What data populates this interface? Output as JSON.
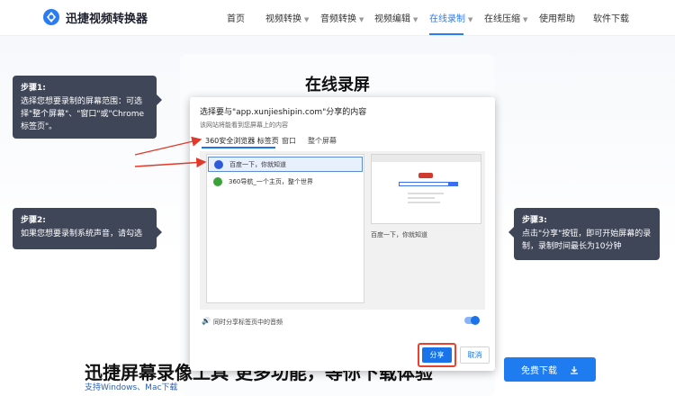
{
  "nav": {
    "brand": "迅捷视频转换器",
    "items": [
      {
        "label": "首页",
        "dropdown": false,
        "active": false
      },
      {
        "label": "视频转换",
        "dropdown": true,
        "active": false
      },
      {
        "label": "音频转换",
        "dropdown": true,
        "active": false
      },
      {
        "label": "视频编辑",
        "dropdown": true,
        "active": false
      },
      {
        "label": "在线录制",
        "dropdown": true,
        "active": true
      },
      {
        "label": "在线压缩",
        "dropdown": true,
        "active": false
      },
      {
        "label": "使用帮助",
        "dropdown": false,
        "active": false
      },
      {
        "label": "软件下载",
        "dropdown": false,
        "active": false
      }
    ],
    "accent_color": "#2b7cf2"
  },
  "page": {
    "title": "在线录屏",
    "heading": "迅捷屏幕录像工具 更多功能，等你下载体验",
    "support": "支持Windows、Mac下载",
    "download_label": "免费下载",
    "download_icon": "download-icon"
  },
  "callouts": [
    {
      "step": "步骤1:",
      "text": "选择您想要录制的屏幕范围：可选择\"整个屏幕\"、\"窗口\"或\"Chrome标签页\"。"
    },
    {
      "step": "步骤2:",
      "text": "如果您想要录制系统声音，请勾选"
    },
    {
      "step": "步骤3:",
      "text": "点击\"分享\"按钮，即可开始屏幕的录制，录制时间最长为10分钟"
    }
  ],
  "dialog": {
    "title": "选择要与\"app.xunjieshipin.com\"分享的内容",
    "subtitle": "该网站将能看到您屏幕上的内容",
    "tabs": [
      "360安全浏览器 标签页",
      "窗口",
      "整个屏幕"
    ],
    "active_tab": 0,
    "tab_list": [
      {
        "label": "百度一下，你就知道",
        "icon": "baidu-paw-icon",
        "selected": true
      },
      {
        "label": "360导航_一个主页，整个世界",
        "icon": "360-nav-icon",
        "selected": false
      }
    ],
    "preview_caption": "百度一下，你就知道",
    "audio_label": "同时分享标签页中的音频",
    "audio_enabled": true,
    "share_label": "分享",
    "cancel_label": "取消",
    "highlight_color": "#e8412f"
  }
}
